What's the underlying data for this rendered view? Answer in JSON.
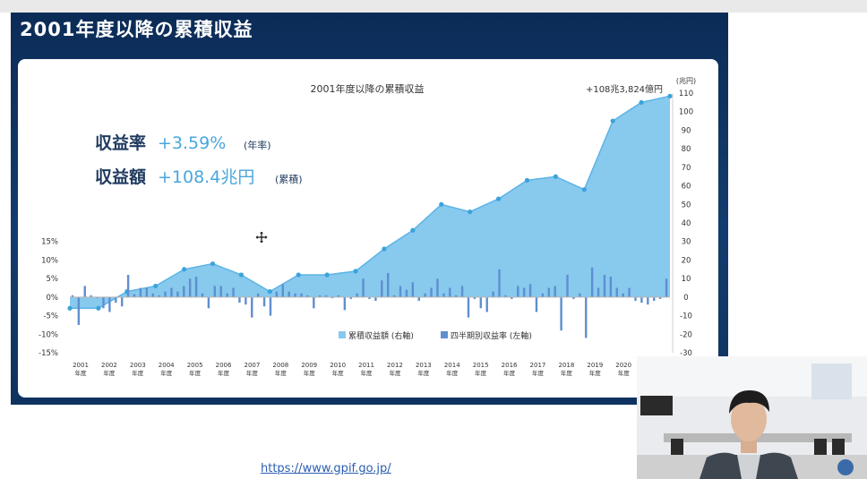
{
  "slide": {
    "title": "2001年度以降の累積収益",
    "url": "https://www.gpif.go.jp/"
  },
  "chart_data": {
    "type": "bar+area",
    "title": "2001年度以降の累積収益",
    "annotation_top": "+108兆3,824億円",
    "right_unit": "(兆円)",
    "summary": [
      {
        "label": "収益率",
        "value": "+3.59%",
        "note": "(年率)"
      },
      {
        "label": "収益額",
        "value": "+108.4兆円",
        "note": "(累積)"
      }
    ],
    "left_axis": {
      "ticks": [
        "15%",
        "10%",
        "5%",
        "0%",
        "-5%",
        "-10%",
        "-15%"
      ],
      "ylim": [
        -15,
        15
      ]
    },
    "right_axis": {
      "ticks": [
        "110",
        "100",
        "90",
        "80",
        "70",
        "60",
        "50",
        "40",
        "30",
        "20",
        "10",
        "0",
        "-10",
        "-20",
        "-30"
      ],
      "ylim": [
        -30,
        110
      ]
    },
    "x_labels": [
      "2001",
      "2002",
      "2003",
      "2004",
      "2005",
      "2006",
      "2007",
      "2008",
      "2009",
      "2010",
      "2011",
      "2012",
      "2013",
      "2014",
      "2015",
      "2016",
      "2017",
      "2018",
      "2019",
      "2020",
      "2021"
    ],
    "x_sublabel": "年度",
    "legend": [
      {
        "name": "累積収益額 (右軸)",
        "color": "#88c9ee"
      },
      {
        "name": "四半期別収益率 (左軸)",
        "color": "#5f8fd0"
      }
    ],
    "cumulative": [
      {
        "fy": 2001,
        "v": -6
      },
      {
        "fy": 2002,
        "v": -6
      },
      {
        "fy": 2003,
        "v": 3
      },
      {
        "fy": 2004,
        "v": 6
      },
      {
        "fy": 2005,
        "v": 15
      },
      {
        "fy": 2006,
        "v": 18
      },
      {
        "fy": 2007,
        "v": 12
      },
      {
        "fy": 2008,
        "v": 3
      },
      {
        "fy": 2009,
        "v": 12
      },
      {
        "fy": 2010,
        "v": 12
      },
      {
        "fy": 2011,
        "v": 14
      },
      {
        "fy": 2012,
        "v": 26
      },
      {
        "fy": 2013,
        "v": 36
      },
      {
        "fy": 2014,
        "v": 50
      },
      {
        "fy": 2015,
        "v": 46
      },
      {
        "fy": 2016,
        "v": 53
      },
      {
        "fy": 2017,
        "v": 63
      },
      {
        "fy": 2018,
        "v": 65
      },
      {
        "fy": 2019,
        "v": 58
      },
      {
        "fy": 2020,
        "v": 95
      },
      {
        "fy": 2021,
        "v": 105
      },
      {
        "fy": 2022,
        "v": 108.4
      }
    ],
    "quarterly": [
      0.5,
      -7.5,
      3.0,
      0.5,
      -0.3,
      -3.0,
      -4.0,
      -1.5,
      -2.5,
      6.0,
      0.8,
      2.5,
      2.5,
      1.0,
      0.5,
      1.5,
      2.5,
      1.5,
      3.0,
      5.0,
      5.5,
      1.0,
      -3.0,
      3.0,
      3.0,
      1.0,
      2.5,
      -1.5,
      -2.0,
      -5.5,
      1.0,
      -2.5,
      -5.0,
      1.5,
      3.5,
      1.5,
      1.0,
      1.0,
      0.5,
      -3.0,
      0.5,
      0.5,
      -0.3,
      0.5,
      -3.5,
      -0.5,
      1.0,
      5.0,
      -0.5,
      -1.0,
      4.5,
      6.5,
      0.5,
      3.0,
      2.0,
      4.0,
      -1.0,
      1.0,
      2.5,
      5.0,
      1.0,
      2.5,
      0.5,
      3.0,
      -5.5,
      -0.5,
      -3.0,
      -4.0,
      1.5,
      7.5,
      0.5,
      -0.5,
      3.0,
      2.5,
      3.5,
      -4.0,
      1.0,
      2.5,
      3.0,
      -9.0,
      6.0,
      -0.5,
      1.0,
      -11.0,
      8.0,
      2.5,
      6.0,
      5.5,
      2.5,
      1.0,
      2.5,
      -1.0,
      -1.5,
      -2.0,
      -1.0,
      -0.5,
      5.0
    ]
  },
  "cursor": {
    "icon": "move-cursor-icon"
  }
}
